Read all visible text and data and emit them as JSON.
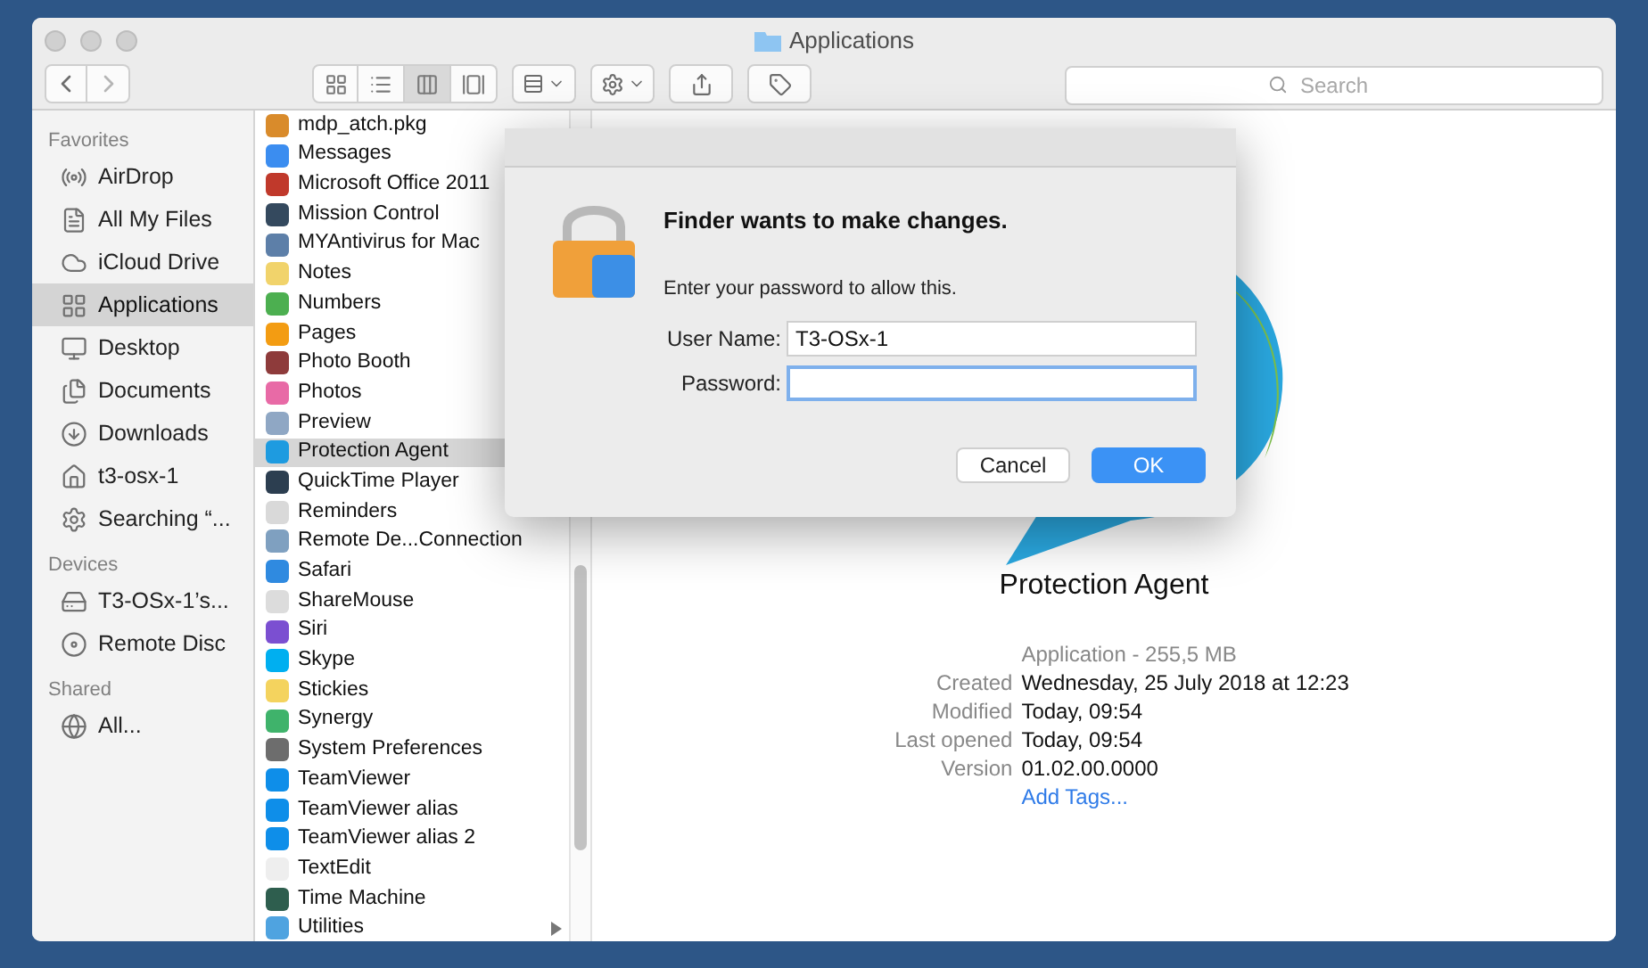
{
  "window": {
    "title": "Applications"
  },
  "toolbar": {
    "view_modes": [
      {
        "kind": "icons",
        "selected": false
      },
      {
        "kind": "list",
        "selected": false
      },
      {
        "kind": "columns",
        "selected": true
      },
      {
        "kind": "coverflow",
        "selected": false
      }
    ]
  },
  "search": {
    "placeholder": "Search"
  },
  "sidebar": {
    "sections": [
      {
        "heading": "Favorites",
        "items": [
          {
            "label": "AirDrop",
            "selected": false
          },
          {
            "label": "All My Files",
            "selected": false
          },
          {
            "label": "iCloud Drive",
            "selected": false
          },
          {
            "label": "Applications",
            "selected": true
          },
          {
            "label": "Desktop",
            "selected": false
          },
          {
            "label": "Documents",
            "selected": false
          },
          {
            "label": "Downloads",
            "selected": false
          },
          {
            "label": "t3-osx-1",
            "selected": false
          },
          {
            "label": "Searching “...",
            "selected": false
          }
        ]
      },
      {
        "heading": "Devices",
        "items": [
          {
            "label": "T3-OSx-1’s...",
            "selected": false
          },
          {
            "label": "Remote Disc",
            "selected": false
          }
        ]
      },
      {
        "heading": "Shared",
        "items": [
          {
            "label": "All...",
            "selected": false
          }
        ]
      }
    ]
  },
  "file_list": {
    "items": [
      {
        "name": "mdp_atch.pkg",
        "selected": false,
        "expandable": false
      },
      {
        "name": "Messages",
        "selected": false,
        "expandable": false
      },
      {
        "name": "Microsoft Office 2011",
        "selected": false,
        "expandable": false
      },
      {
        "name": "Mission Control",
        "selected": false,
        "expandable": false
      },
      {
        "name": "MYAntivirus for Mac",
        "selected": false,
        "expandable": false
      },
      {
        "name": "Notes",
        "selected": false,
        "expandable": false
      },
      {
        "name": "Numbers",
        "selected": false,
        "expandable": false
      },
      {
        "name": "Pages",
        "selected": false,
        "expandable": false
      },
      {
        "name": "Photo Booth",
        "selected": false,
        "expandable": false
      },
      {
        "name": "Photos",
        "selected": false,
        "expandable": false
      },
      {
        "name": "Preview",
        "selected": false,
        "expandable": false
      },
      {
        "name": "Protection Agent",
        "selected": true,
        "expandable": false
      },
      {
        "name": "QuickTime Player",
        "selected": false,
        "expandable": false
      },
      {
        "name": "Reminders",
        "selected": false,
        "expandable": false
      },
      {
        "name": "Remote De...Connection",
        "selected": false,
        "expandable": false
      },
      {
        "name": "Safari",
        "selected": false,
        "expandable": false
      },
      {
        "name": "ShareMouse",
        "selected": false,
        "expandable": false
      },
      {
        "name": "Siri",
        "selected": false,
        "expandable": false
      },
      {
        "name": "Skype",
        "selected": false,
        "expandable": false
      },
      {
        "name": "Stickies",
        "selected": false,
        "expandable": false
      },
      {
        "name": "Synergy",
        "selected": false,
        "expandable": false
      },
      {
        "name": "System Preferences",
        "selected": false,
        "expandable": false
      },
      {
        "name": "TeamViewer",
        "selected": false,
        "expandable": false
      },
      {
        "name": "TeamViewer alias",
        "selected": false,
        "expandable": false
      },
      {
        "name": "TeamViewer alias 2",
        "selected": false,
        "expandable": false
      },
      {
        "name": "TextEdit",
        "selected": false,
        "expandable": false
      },
      {
        "name": "Time Machine",
        "selected": false,
        "expandable": false
      },
      {
        "name": "Utilities",
        "selected": false,
        "expandable": true
      }
    ]
  },
  "preview": {
    "name": "Protection Agent",
    "kind_size": "Application - 255,5 MB",
    "details": [
      {
        "label": "Created",
        "value": "Wednesday, 25 July 2018 at 12:23"
      },
      {
        "label": "Modified",
        "value": "Today, 09:54"
      },
      {
        "label": "Last opened",
        "value": "Today, 09:54"
      },
      {
        "label": "Version",
        "value": "01.02.00.0000"
      }
    ],
    "add_tags": "Add Tags..."
  },
  "dialog": {
    "title": "Finder wants to make changes.",
    "message": "Enter your password to allow this.",
    "fields": [
      {
        "label": "User Name:",
        "value": "T3-OSx-1",
        "focused": false
      },
      {
        "label": "Password:",
        "focused": true
      }
    ],
    "buttons": [
      {
        "label": "Cancel",
        "default": false
      },
      {
        "label": "OK",
        "default": true
      }
    ]
  }
}
